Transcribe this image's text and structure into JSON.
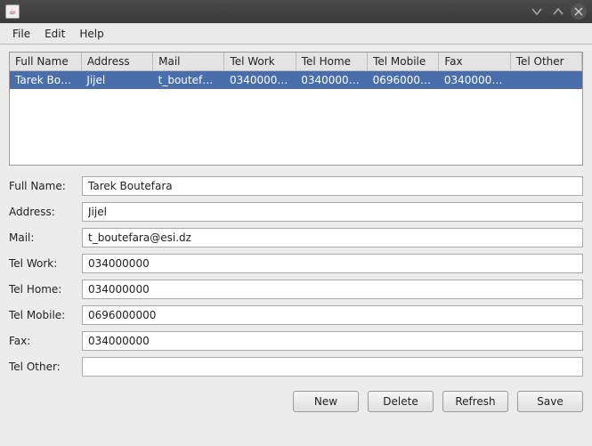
{
  "menu": {
    "file": "File",
    "edit": "Edit",
    "help": "Help"
  },
  "table": {
    "headers": {
      "full_name": "Full Name",
      "address": "Address",
      "mail": "Mail",
      "tel_work": "Tel Work",
      "tel_home": "Tel Home",
      "tel_mobile": "Tel Mobile",
      "fax": "Fax",
      "tel_other": "Tel Other"
    },
    "rows": [
      {
        "full_name": "Tarek Bo…",
        "address": "Jijel",
        "mail": "t_boutef…",
        "tel_work": "0340000…",
        "tel_home": "0340000…",
        "tel_mobile": "0696000…",
        "fax": "0340000…",
        "tel_other": ""
      }
    ]
  },
  "form": {
    "labels": {
      "full_name": "Full Name:",
      "address": "Address:",
      "mail": "Mail:",
      "tel_work": "Tel Work:",
      "tel_home": "Tel Home:",
      "tel_mobile": "Tel Mobile:",
      "fax": "Fax:",
      "tel_other": "Tel Other:"
    },
    "values": {
      "full_name": "Tarek Boutefara",
      "address": "Jijel",
      "mail": "t_boutefara@esi.dz",
      "tel_work": "034000000",
      "tel_home": "034000000",
      "tel_mobile": "0696000000",
      "fax": "034000000",
      "tel_other": ""
    }
  },
  "buttons": {
    "new": "New",
    "delete": "Delete",
    "refresh": "Refresh",
    "save": "Save"
  }
}
